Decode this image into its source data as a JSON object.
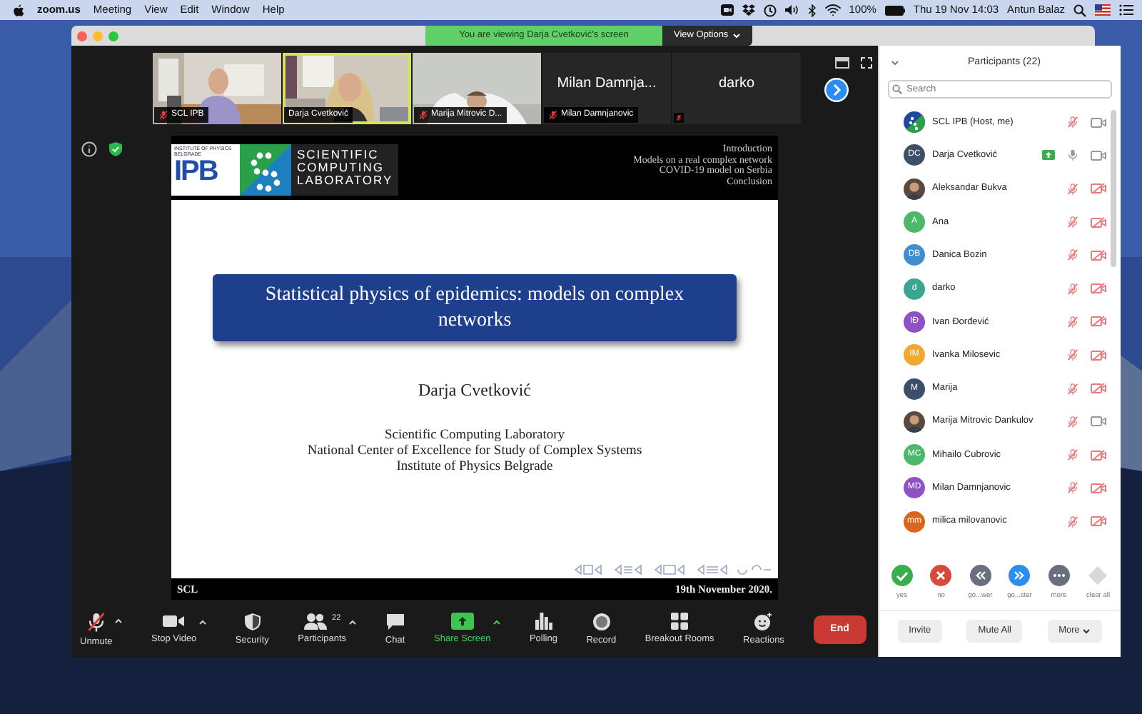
{
  "menu_bar": {
    "app": "zoom.us",
    "items": [
      "Meeting",
      "View",
      "Edit",
      "Window",
      "Help"
    ],
    "battery": "100%",
    "datetime": "Thu 19 Nov 14:03",
    "user": "Antun Balaz"
  },
  "window": {
    "banner": "You are viewing Darja Cvetković's screen",
    "view_options": "View Options"
  },
  "thumbnails": [
    {
      "kind": "video",
      "label": "SCL IPB",
      "muted": true,
      "active_speaker": false
    },
    {
      "kind": "video",
      "label": "Darja Cvetković",
      "muted": false,
      "active_speaker": true
    },
    {
      "kind": "video",
      "label": "Marija Mitrovic D...",
      "muted": true,
      "active_speaker": false
    },
    {
      "kind": "name",
      "display": "Milan Damnja...",
      "label": "Milan Damnjanovic",
      "muted": true,
      "active_speaker": false
    },
    {
      "kind": "name",
      "display": "darko",
      "muted": true,
      "active_speaker": false
    }
  ],
  "slide": {
    "institute": "INSTITUTE OF PHYSICS BELGRADE",
    "institute_logo": "IPB",
    "lab": [
      "SCIENTIFIC",
      "COMPUTING",
      "LABORATORY"
    ],
    "outline": [
      "Introduction",
      "Models on a real complex network",
      "COVID-19 model on Serbia",
      "Conclusion"
    ],
    "title": "Statistical physics of epidemics: models on complex networks",
    "author": "Darja Cvetković",
    "affiliations": [
      "Scientific Computing Laboratory",
      "National Center of Excellence for Study of Complex Systems",
      "Institute of Physics Belgrade"
    ],
    "footer_left": "SCL",
    "footer_right": "19th November 2020."
  },
  "toolbar": [
    {
      "kind": "mute",
      "label": "Unmute",
      "has_menu": true
    },
    {
      "kind": "video",
      "label": "Stop Video",
      "has_menu": true
    },
    {
      "kind": "security",
      "label": "Security",
      "has_menu": false
    },
    {
      "kind": "participants",
      "label": "Participants",
      "count": "22",
      "has_menu": true
    },
    {
      "kind": "chat",
      "label": "Chat",
      "has_menu": false
    },
    {
      "kind": "share",
      "label": "Share Screen",
      "has_menu": true
    },
    {
      "kind": "polling",
      "label": "Polling",
      "has_menu": false
    },
    {
      "kind": "record",
      "label": "Record",
      "has_menu": false
    },
    {
      "kind": "breakout",
      "label": "Breakout Rooms",
      "has_menu": false
    },
    {
      "kind": "reactions",
      "label": "Reactions",
      "has_menu": false
    },
    {
      "kind": "end",
      "label": "End"
    }
  ],
  "participants": {
    "title": "Participants (22)",
    "search": {
      "placeholder": "Search"
    },
    "list": [
      {
        "name": "SCL IPB (Host, me)",
        "avatar": {
          "kind": "logo"
        },
        "sharing": false,
        "muted": true,
        "video": true
      },
      {
        "name": "Darja Cvetković",
        "avatar": {
          "kind": "initials",
          "initials": "DC",
          "color": "#3d5066"
        },
        "sharing": true,
        "muted": false,
        "video": true
      },
      {
        "name": "Aleksandar Bukva",
        "sharing": false,
        "muted": true,
        "video": false
      },
      {
        "name": "Ana",
        "avatar": {
          "kind": "initials",
          "initials": "A",
          "color": "#4cb86a"
        },
        "sharing": false,
        "muted": true,
        "video": false
      },
      {
        "name": "Danica Bozin",
        "avatar": {
          "kind": "initials",
          "initials": "DB",
          "color": "#3e8ed0"
        },
        "sharing": false,
        "muted": true,
        "video": false
      },
      {
        "name": "darko",
        "avatar": {
          "kind": "initials",
          "initials": "d",
          "color": "#3aa692"
        },
        "sharing": false,
        "muted": true,
        "video": false
      },
      {
        "name": "Ivan Đorđević",
        "avatar": {
          "kind": "initials",
          "initials": "IĐ",
          "color": "#8e52c4"
        },
        "sharing": false,
        "muted": true,
        "video": false
      },
      {
        "name": "Ivanka Milosevic",
        "avatar": {
          "kind": "initials",
          "initials": "IM",
          "color": "#f0a830"
        },
        "sharing": false,
        "muted": true,
        "video": false
      },
      {
        "name": "Marija",
        "avatar": {
          "kind": "initials",
          "initials": "M",
          "color": "#3b4f6a"
        },
        "sharing": false,
        "muted": true,
        "video": false
      },
      {
        "name": "Marija Mitrovic Dankulov",
        "sharing": false,
        "muted": true,
        "video": true
      },
      {
        "name": "Mihailo Cubrovic",
        "avatar": {
          "kind": "initials",
          "initials": "MC",
          "color": "#4cb86a"
        },
        "sharing": false,
        "muted": true,
        "video": false
      },
      {
        "name": "Milan Damnjanovic",
        "avatar": {
          "kind": "initials",
          "initials": "MD",
          "color": "#8e52c4"
        },
        "sharing": false,
        "muted": true,
        "video": false
      },
      {
        "name": "milica milovanovic",
        "avatar": {
          "kind": "initials",
          "initials": "mm",
          "color": "#d9661f"
        },
        "sharing": false,
        "muted": true,
        "video": false
      }
    ],
    "reactions": [
      {
        "kind": "check",
        "label": "yes",
        "color": "#3aae4a"
      },
      {
        "kind": "cross",
        "label": "no",
        "color": "#d9493a"
      },
      {
        "kind": "slower",
        "label": "go...wer",
        "color": "#6a6f80"
      },
      {
        "kind": "faster",
        "label": "go...ster",
        "color": "#2d8cf0"
      },
      {
        "kind": "more",
        "label": "more",
        "color": "#6a6f80"
      },
      {
        "kind": "clear",
        "label": "clear all",
        "color": "#d8d8dc"
      }
    ],
    "buttons": [
      {
        "kind": "plain",
        "label": "Invite"
      },
      {
        "kind": "plain",
        "label": "Mute All"
      },
      {
        "kind": "menu",
        "label": "More"
      }
    ]
  }
}
